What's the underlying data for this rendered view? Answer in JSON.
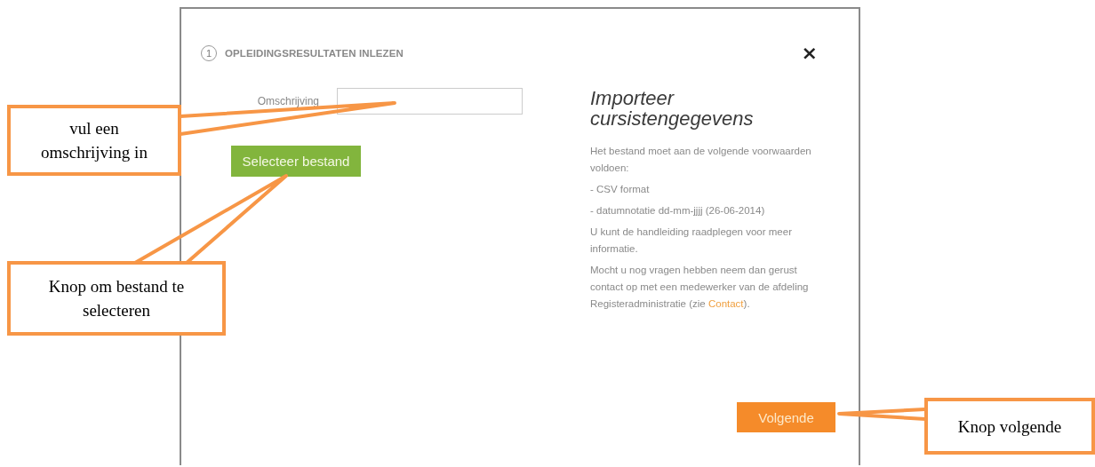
{
  "dialog": {
    "step_number": "1",
    "title": "OPLEIDINGSRESULTATEN INLEZEN",
    "close": "×",
    "form": {
      "field_label": "Omschrijving",
      "select_button": "Selecteer bestand"
    },
    "info": {
      "heading": "Importeer cursistengegevens",
      "paragraphs": [
        {
          "kind": "text",
          "text": "Het bestand moet aan de volgende voorwaarden voldoen:"
        },
        {
          "kind": "text",
          "text": "- CSV format"
        },
        {
          "kind": "text",
          "text": "- datumnotatie dd-mm-jjjj (26-06-2014)"
        },
        {
          "kind": "text",
          "text": "U kunt de handleiding raadplegen voor meer informatie."
        },
        {
          "kind": "link",
          "before": "Mocht u nog vragen hebben neem dan gerust contact op met een medewerker van de afdeling Registeradministratie (zie ",
          "link": "Contact",
          "after": ")."
        }
      ]
    },
    "next_button": "Volgende"
  },
  "annotations": [
    {
      "text": "vul een omschrijving in"
    },
    {
      "text": "Knop om bestand te selecteren"
    },
    {
      "text": "Knop volgende"
    }
  ]
}
